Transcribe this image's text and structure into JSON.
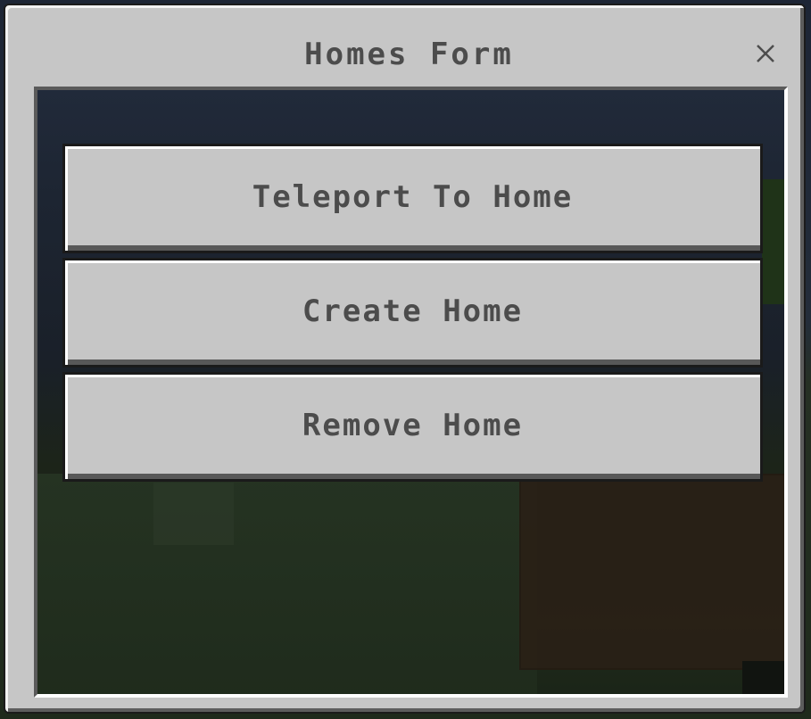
{
  "dialog": {
    "title": "Homes Form",
    "close_icon": "close-icon"
  },
  "buttons": [
    {
      "label": "Teleport To Home"
    },
    {
      "label": "Create Home"
    },
    {
      "label": "Remove Home"
    }
  ],
  "colors": {
    "frame": "#c6c6c6",
    "text": "#4c4c4c",
    "panel_bg": "#1d2532"
  }
}
